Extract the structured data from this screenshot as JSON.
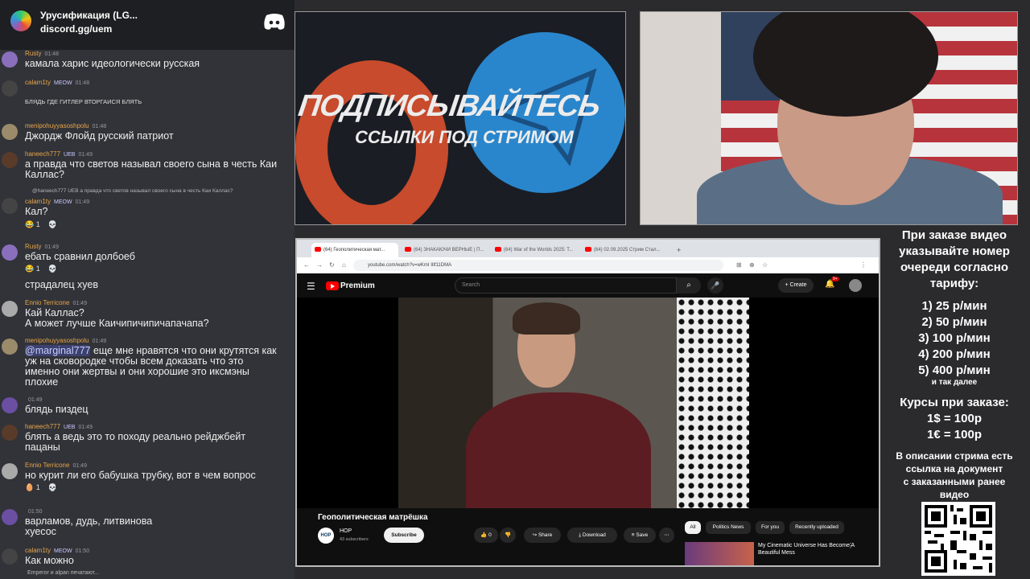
{
  "discord": {
    "server_name": "Урусификация (LG...",
    "invite": "discord.gg/uem",
    "typing": "Emperor и alpan печатают...",
    "messages": [
      {
        "user": "Rusty",
        "time": "01:48",
        "text": "камала харис идеологически русская",
        "color": "#e0a84d"
      },
      {
        "user": "calam1ty",
        "badge": "MEOW",
        "time": "01:48",
        "reply": "БЛЯДЬ ГДЕ ГИТЛЕР ВТОРГАИСЯ БЛЯТЬ",
        "color": "#e0a84d"
      },
      {
        "user": "menipohuyyasoshpolu",
        "time": "01:48",
        "text": "Джордж Флойд русский патриот",
        "color": "#e0a84d"
      },
      {
        "user": "haneech777",
        "badge": "UEB",
        "time": "01:49",
        "text": "а правда что светов называл своего сына в честь Каи",
        "text2": "Каллас?",
        "color": "#e0a84d"
      },
      {
        "user": "calam1ty",
        "badge": "MEOW",
        "time": "01:49",
        "reply": "@haneech777 UEB а правда что светов называл своего сына в честь Каи Каллас?",
        "text": "Кал?",
        "reacts": [
          "😂 1",
          "💀"
        ],
        "color": "#e0a84d"
      },
      {
        "user": "Rusty",
        "time": "01:49",
        "text": "ебать сравнил долбоеб",
        "reacts": [
          "😂 1",
          "💀"
        ],
        "text3": "страдалец хуев",
        "color": "#e0a84d"
      },
      {
        "user": "Ennio Terricone",
        "time": "01:49",
        "text": "Кай Каллас?",
        "text2": "А может лучше Каичипичипичапачапа?",
        "color": "#e0a84d"
      },
      {
        "user": "menipohuyyasoshpolu",
        "time": "01:49",
        "mention": "@marginal777",
        "text": " еще мне нравятся что они крутятся как",
        "text2": "уж на сковородке чтобы всем доказать что это",
        "text3": "именно они жертвы и они хорошие это иксмэны",
        "text4": "плохие",
        "color": "#e0a84d"
      },
      {
        "user": "",
        "time": "01:49",
        "text": "блядь пиздец",
        "color": "#e0a84d"
      },
      {
        "user": "haneech777",
        "badge": "UEB",
        "time": "01:49",
        "text": "блять а ведь это то походу реально рейджбейт",
        "text2": "пацаны",
        "color": "#e0a84d"
      },
      {
        "user": "Ennio Terricone",
        "time": "01:49",
        "text": "но курит ли его бабушка трубку, вот в чем вопрос",
        "reacts": [
          "🥚 1",
          "💀"
        ],
        "color": "#e0a84d"
      },
      {
        "user": "",
        "time": "01:50",
        "text": "варламов, дудь, литвинова",
        "text2": "хуесос",
        "color": "#e0a84d"
      },
      {
        "user": "calam1ty",
        "badge": "MEOW",
        "time": "01:50",
        "text": "Как можно",
        "color": "#e0a84d"
      }
    ]
  },
  "banner": {
    "line1": "ПОДПИСЫВАЙТЕСЬ",
    "line2": "ССЫЛКИ ПОД СТРИМОМ"
  },
  "info": {
    "lines": [
      "При заказе видео",
      "указывайте номер",
      "очереди согласно",
      "тарифу:",
      "1) 25 р/мин",
      "2) 50 р/мин",
      "3) 100 р/мин",
      "4) 200 р/мин",
      "5) 400 р/мин",
      "и так далее",
      "Курсы при заказе:",
      "1$ = 100р",
      "1€ = 100р",
      "В описании стрима есть",
      "ссылка на документ",
      "с заказанными ранее",
      "видео"
    ]
  },
  "browser": {
    "tabs": [
      "(64) Геополитическая мат...",
      "(64) ЗНАКАЮЧИ ВЕРНЫЕ | П...",
      "(64) War of the Worlds 2025: T...",
      "(64) 02.09.2025 Стрим Стал..."
    ],
    "url": "youtube.com/watch?v=wKmI IlIf11DMA",
    "youtube": {
      "logo_text": "Premium",
      "search_placeholder": "Search",
      "create_label": "Create",
      "notif_count": "9+",
      "video_title": "Геополитическая матрёшка",
      "channel_initials": "НОР",
      "channel_name": "НОР",
      "subscribers": "43 subscribers",
      "subscribe_label": "Subscribe",
      "likes": "0",
      "share_label": "Share",
      "download_label": "Download",
      "save_label": "Save",
      "chips": [
        "All",
        "Politics News",
        "For you",
        "Recently uploaded"
      ],
      "rec_title": "My Cinematic Universe Has Become A Beautiful Mess"
    }
  }
}
